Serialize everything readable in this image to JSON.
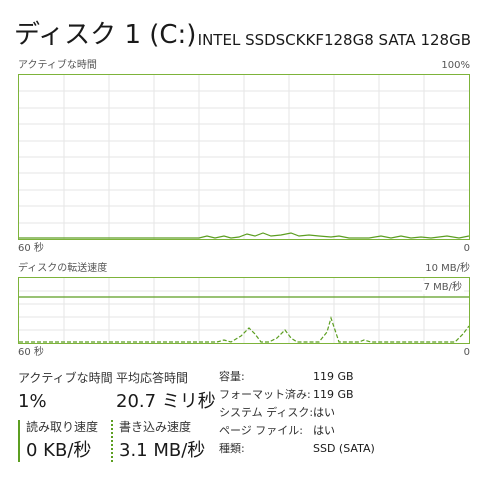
{
  "header": {
    "title": "ディスク 1 (C:)",
    "model": "INTEL SSDSCKKF128G8 SATA 128GB"
  },
  "active_time_graph": {
    "label": "アクティブな時間",
    "max_label": "100%",
    "time_label": "60 秒",
    "min_label": "0"
  },
  "transfer_graph": {
    "label": "ディスクの転送速度",
    "max_label": "10 MB/秒",
    "line_label": "7 MB/秒",
    "time_label": "60 秒",
    "min_label": "0"
  },
  "stats": {
    "active_time": {
      "label": "アクティブな時間",
      "value": "1%"
    },
    "response_time": {
      "label": "平均応答時間",
      "value": "20.7 ミリ秒"
    },
    "read_speed": {
      "label": "読み取り速度",
      "value": "0 KB/秒"
    },
    "write_speed": {
      "label": "書き込み速度",
      "value": "3.1 MB/秒"
    }
  },
  "properties": [
    {
      "label": "容量:",
      "value": "119 GB"
    },
    {
      "label": "フォーマット済み:",
      "value": "119 GB"
    },
    {
      "label": "システム ディスク:",
      "value": "はい"
    },
    {
      "label": "ページ ファイル:",
      "value": "はい"
    },
    {
      "label": "種類:",
      "value": "SSD (SATA)"
    }
  ],
  "colors": {
    "accent": "#5c9e21",
    "graph_border": "#7db33a",
    "grid": "#e5e5e5"
  }
}
